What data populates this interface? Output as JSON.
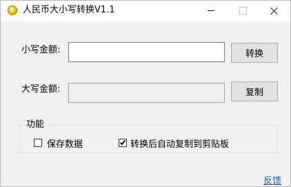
{
  "window": {
    "title": "人民币大小写转换V1.1",
    "app_icon": "coin-icon",
    "controls": {
      "minimize_icon": "minimize-icon",
      "maximize_icon": "maximize-icon",
      "close_icon": "close-icon"
    }
  },
  "form": {
    "lowercase_label": "小写金额:",
    "lowercase_value": "",
    "convert_label": "转换",
    "uppercase_label": "大写金额:",
    "uppercase_value": "",
    "copy_label": "复制"
  },
  "options": {
    "group_title": "功能",
    "save_data": {
      "label": "保存数据",
      "checked": false
    },
    "auto_copy": {
      "label": "转换后自动复制到剪贴板",
      "checked": true
    }
  },
  "footer": {
    "feedback_label": "反馈"
  },
  "colors": {
    "link": "#0066cc",
    "background": "#f0f0f0",
    "button": "#e1e1e1"
  }
}
